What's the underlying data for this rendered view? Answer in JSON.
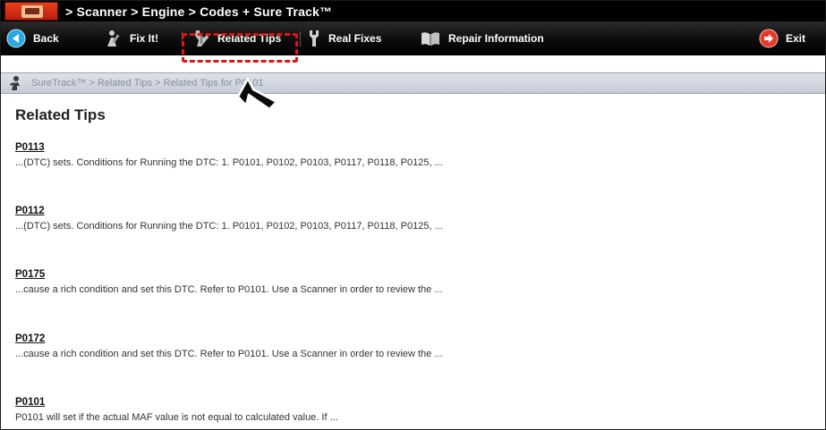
{
  "titlebar": {
    "path": "> Scanner  > Engine  > Codes + Sure Track™"
  },
  "toolbar": {
    "back_label": "Back",
    "fixit_label": "Fix It!",
    "related_tips_label": "Related Tips",
    "real_fixes_label": "Real Fixes",
    "repair_info_label": "Repair Information",
    "exit_label": "Exit"
  },
  "breadcrumb": {
    "text": "SureTrack™  > Related Tips > Related Tips for P0101"
  },
  "main": {
    "heading": "Related Tips",
    "tips": [
      {
        "code": "P0113",
        "snippet": "...(DTC) sets. Conditions for Running the DTC: 1. P0101, P0102, P0103, P0117, P0118, P0125, ..."
      },
      {
        "code": "P0112",
        "snippet": "...(DTC) sets. Conditions for Running the DTC: 1. P0101, P0102, P0103, P0117, P0118, P0125, ..."
      },
      {
        "code": "P0175",
        "snippet": "...cause a rich condition and set this DTC. Refer to P0101. Use a Scanner in order to review the ..."
      },
      {
        "code": "P0172",
        "snippet": "...cause a rich condition and set this DTC. Refer to P0101. Use a Scanner in order to review the ..."
      },
      {
        "code": "P0101",
        "snippet": "P0101 will set if the actual MAF value is not equal to calculated value.  If ..."
      }
    ]
  },
  "colors": {
    "highlight": "#e01414",
    "logo": "#e8401c",
    "back_icon": "#2aa7e0",
    "exit_icon": "#e5392a"
  },
  "icons": {
    "back": "back-arrow-icon",
    "fixit": "wrench-person-icon",
    "related_tips": "tips-wrench-icon",
    "real_fixes": "wrench-icon",
    "repair_info": "book-icon",
    "exit": "exit-arrow-icon",
    "breadcrumb": "person-icon"
  }
}
